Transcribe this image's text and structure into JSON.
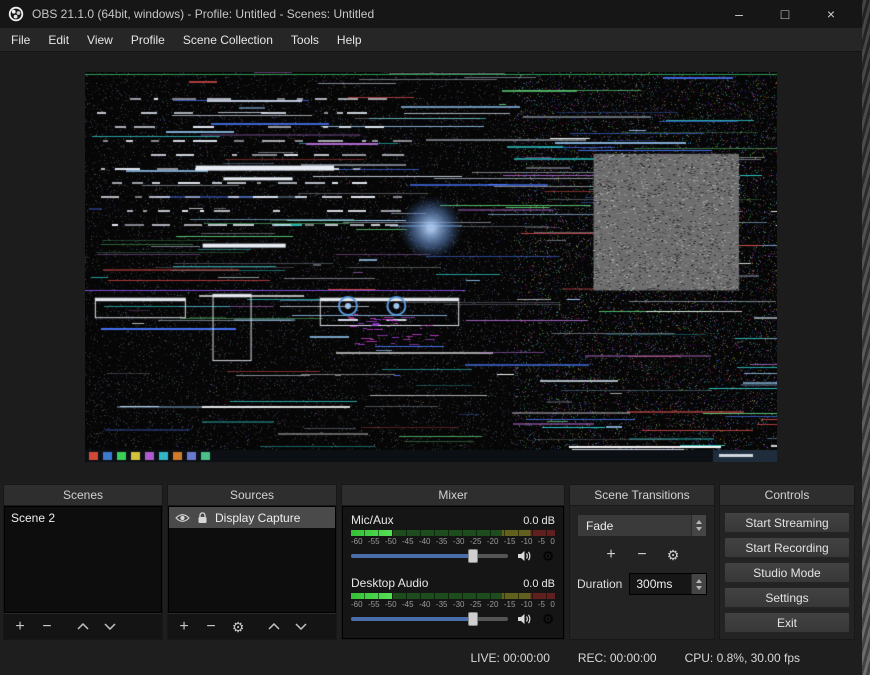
{
  "colors": {
    "accent_blue": "#4a6ea9",
    "meter_green": "#35c135",
    "meter_yellow": "#61611d",
    "meter_red": "#612020"
  },
  "titlebar": {
    "title": "OBS 21.1.0 (64bit, windows) - Profile: Untitled - Scenes: Untitled"
  },
  "icons": {
    "minimize": "–",
    "maximize": "□",
    "close": "×",
    "plus": "+",
    "minus": "−",
    "gear": "⚙"
  },
  "menu": {
    "items": [
      "File",
      "Edit",
      "View",
      "Profile",
      "Scene Collection",
      "Tools",
      "Help"
    ]
  },
  "panels": {
    "scenes": {
      "title": "Scenes",
      "items": [
        "Scene 2"
      ]
    },
    "sources": {
      "title": "Sources",
      "items": [
        {
          "label": "Display Capture"
        }
      ]
    },
    "mixer": {
      "title": "Mixer",
      "channels": [
        {
          "name": "Mic/Aux",
          "level": "0.0 dB"
        },
        {
          "name": "Desktop Audio",
          "level": "0.0 dB"
        }
      ],
      "scale": [
        "-60",
        "-55",
        "-50",
        "-45",
        "-40",
        "-35",
        "-30",
        "-25",
        "-20",
        "-15",
        "-10",
        "-5",
        "0"
      ]
    },
    "transitions": {
      "title": "Scene Transitions",
      "selected": "Fade",
      "duration_label": "Duration",
      "duration_value": "300ms"
    },
    "controls": {
      "title": "Controls",
      "buttons": [
        "Start Streaming",
        "Start Recording",
        "Studio Mode",
        "Settings",
        "Exit"
      ]
    }
  },
  "statusbar": {
    "live": "LIVE: 00:00:00",
    "rec": "REC: 00:00:00",
    "cpu": "CPU: 0.8%, 30.00 fps"
  }
}
